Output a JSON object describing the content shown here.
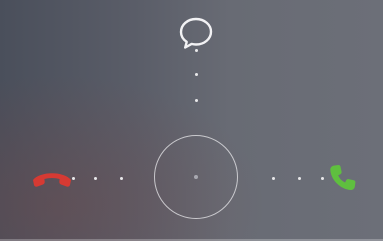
{
  "screen": {
    "name": "incoming-call-lockscreen",
    "colors": {
      "decline": "#d63a33",
      "answer": "#5fbf3f",
      "message": "#f2f2f4",
      "track_dot": "#e8e8ea",
      "ring": "#ebebee"
    }
  },
  "actions": {
    "message": {
      "icon": "message-bubble-icon"
    },
    "decline": {
      "icon": "phone-hangup-icon"
    },
    "answer": {
      "icon": "phone-answer-icon"
    }
  },
  "slider": {
    "handle": "drag-ring"
  }
}
